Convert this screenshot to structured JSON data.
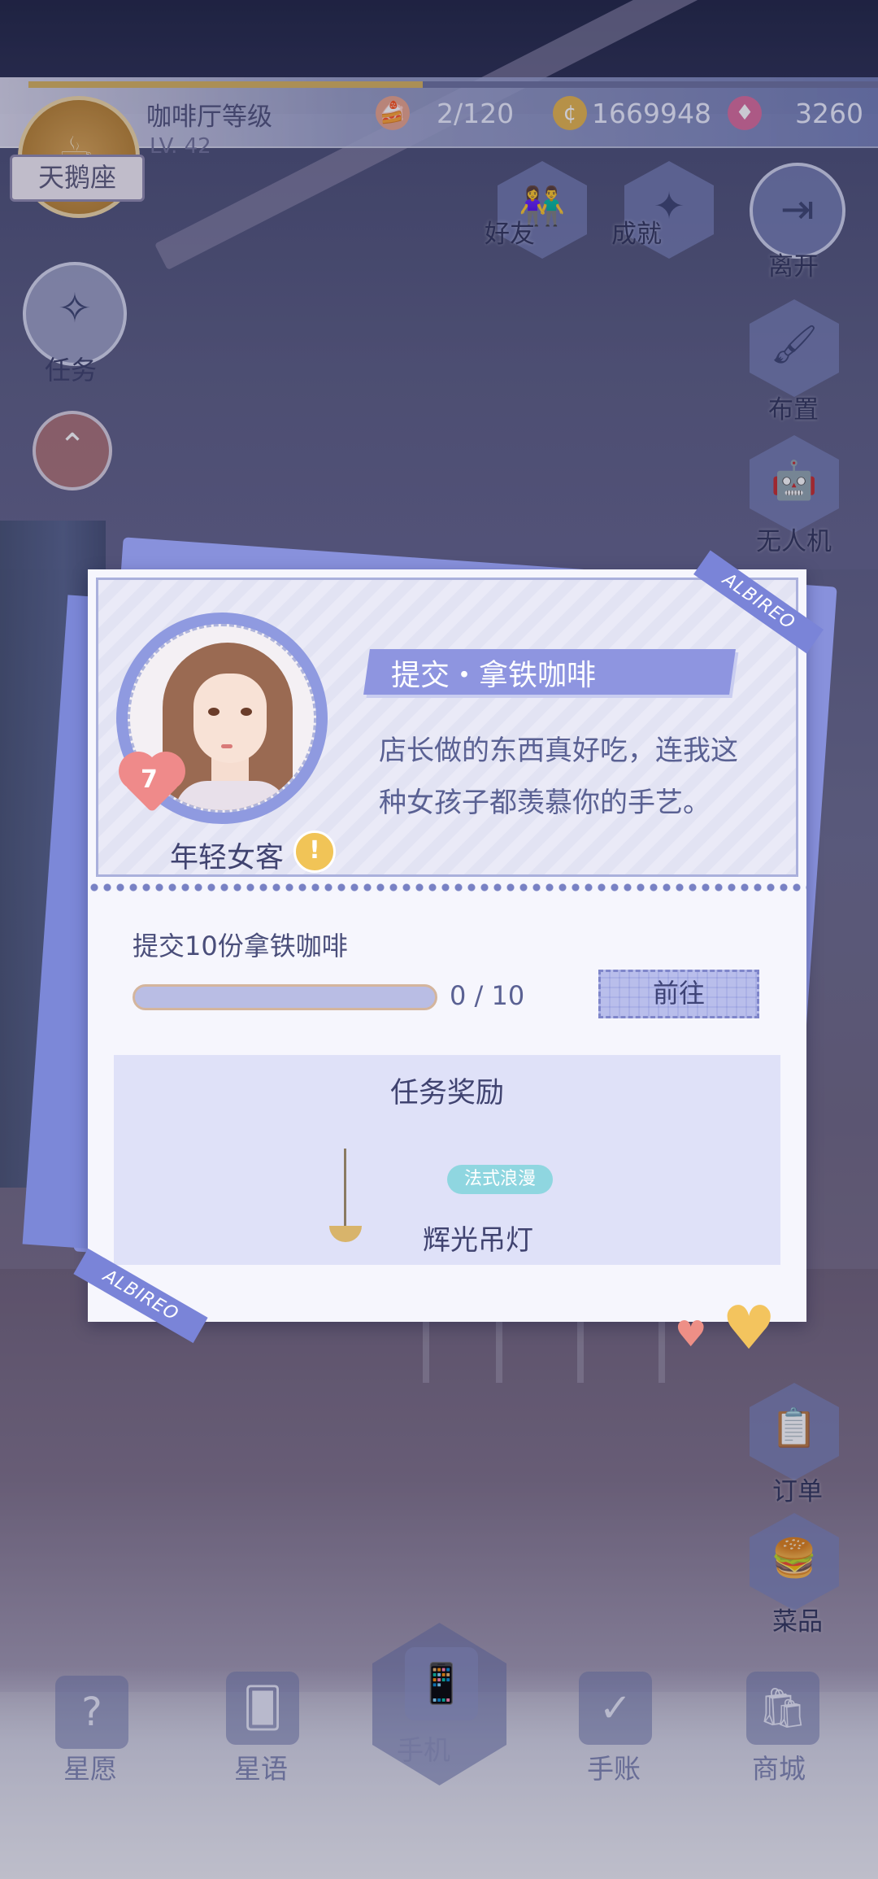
{
  "top_bar": {
    "cafe_badge_label": "天鹅座",
    "cafe_title": "咖啡厅等级",
    "cafe_level": "LV. 42",
    "resources": [
      {
        "name": "stamina",
        "icon": "cake-icon",
        "value": "2/120"
      },
      {
        "name": "gold",
        "icon": "coin-icon",
        "value": "1669948"
      },
      {
        "name": "gems",
        "icon": "crystal-icon",
        "value": "3260"
      }
    ]
  },
  "top_buttons": {
    "friends": "好友",
    "achievement": "成就",
    "leave": "离开"
  },
  "left_buttons": {
    "tasks": "任务"
  },
  "right_buttons": {
    "layout": "布置",
    "drone": "无人机",
    "orders": "订单",
    "menu": "菜品"
  },
  "modal": {
    "npc": {
      "name": "年轻女客",
      "affinity_level": "7",
      "alert_mark": "!"
    },
    "quest_title": "提交・拿铁咖啡",
    "dialog_text": "店长做的东西真好吃，连我这种女孩子都羡慕你的手艺。",
    "ribbon_text": "ALBIREO",
    "task_description": "提交10份拿铁咖啡",
    "progress": {
      "current": 0,
      "total": 10,
      "label": "0 / 10"
    },
    "go_button": "前往",
    "reward": {
      "title": "任务奖励",
      "item_tag": "法式浪漫",
      "item_name": "辉光吊灯"
    }
  },
  "bottom_nav": {
    "wish": "星愿",
    "star_talk": "星语",
    "phone": "手机",
    "journal": "手账",
    "shop": "商城"
  },
  "colors": {
    "modal_accent": "#8e95e0",
    "progress_bar": "#b9bde4",
    "alert": "#f1c457",
    "heart": "#ef8a8a"
  }
}
